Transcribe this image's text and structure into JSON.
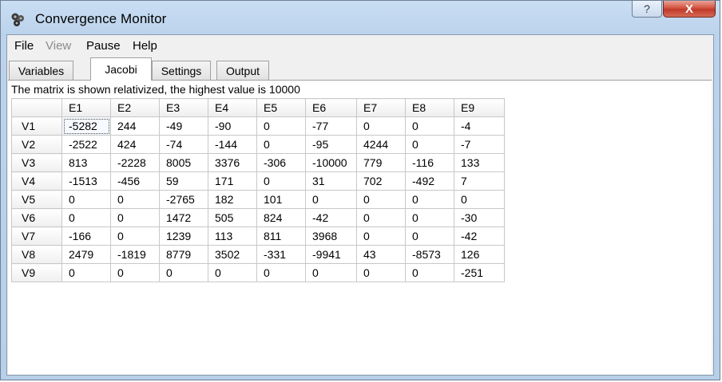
{
  "window": {
    "title": "Convergence Monitor",
    "help_symbol": "?",
    "close_symbol": "X"
  },
  "menu": [
    "File",
    "View",
    "Pause",
    "Help"
  ],
  "tabs": [
    "Variables",
    "Jacobi",
    "Settings",
    "Output"
  ],
  "active_tab": "Jacobi",
  "info_text": "The matrix is shown relativized, the highest value is 10000",
  "matrix": {
    "columns": [
      "E1",
      "E2",
      "E3",
      "E4",
      "E5",
      "E6",
      "E7",
      "E8",
      "E9"
    ],
    "rows": [
      {
        "label": "V1",
        "values": [
          "-5282",
          "244",
          "-49",
          "-90",
          "0",
          "-77",
          "0",
          "0",
          "-4"
        ]
      },
      {
        "label": "V2",
        "values": [
          "-2522",
          "424",
          "-74",
          "-144",
          "0",
          "-95",
          "4244",
          "0",
          "-7"
        ]
      },
      {
        "label": "V3",
        "values": [
          "813",
          "-2228",
          "8005",
          "3376",
          "-306",
          "-10000",
          "779",
          "-116",
          "133"
        ]
      },
      {
        "label": "V4",
        "values": [
          "-1513",
          "-456",
          "59",
          "171",
          "0",
          "31",
          "702",
          "-492",
          "7"
        ]
      },
      {
        "label": "V5",
        "values": [
          "0",
          "0",
          "-2765",
          "182",
          "101",
          "0",
          "0",
          "0",
          "0"
        ]
      },
      {
        "label": "V6",
        "values": [
          "0",
          "0",
          "1472",
          "505",
          "824",
          "-42",
          "0",
          "0",
          "-30"
        ]
      },
      {
        "label": "V7",
        "values": [
          "-166",
          "0",
          "1239",
          "113",
          "811",
          "3968",
          "0",
          "0",
          "-42"
        ]
      },
      {
        "label": "V8",
        "values": [
          "2479",
          "-1819",
          "8779",
          "3502",
          "-331",
          "-9941",
          "43",
          "-8573",
          "126"
        ]
      },
      {
        "label": "V9",
        "values": [
          "0",
          "0",
          "0",
          "0",
          "0",
          "0",
          "0",
          "0",
          "-251"
        ]
      }
    ]
  }
}
